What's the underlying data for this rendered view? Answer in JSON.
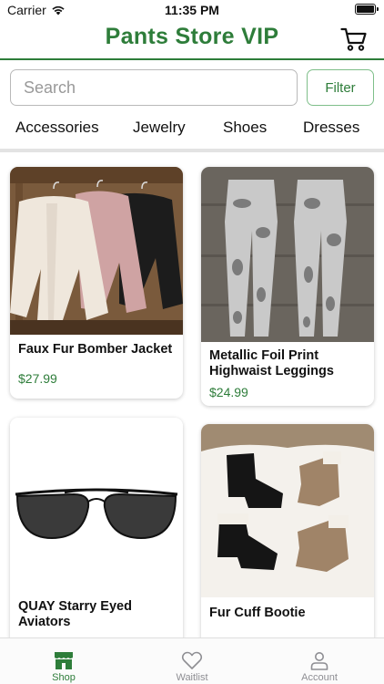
{
  "status_bar": {
    "carrier": "Carrier",
    "time": "11:35 PM"
  },
  "header": {
    "title": "Pants Store VIP",
    "cart_icon": "cart-icon"
  },
  "search": {
    "placeholder": "Search",
    "filter_label": "Filter"
  },
  "categories": [
    "Accessories",
    "Jewelry",
    "Shoes",
    "Dresses"
  ],
  "products": [
    {
      "name": "Faux Fur Bomber Jacket",
      "price": "$27.99"
    },
    {
      "name": "Metallic Foil Print Highwaist Leggings",
      "price": "$24.99"
    },
    {
      "name": "QUAY Starry Eyed Aviators",
      "price": ""
    },
    {
      "name": "Fur Cuff Bootie",
      "price": ""
    }
  ],
  "tabs": [
    {
      "label": "Shop",
      "icon": "store-icon",
      "active": true
    },
    {
      "label": "Waitlist",
      "icon": "heart-icon",
      "active": false
    },
    {
      "label": "Account",
      "icon": "person-icon",
      "active": false
    }
  ],
  "colors": {
    "brand": "#2e7d3a",
    "inactive": "#8e8e93"
  }
}
